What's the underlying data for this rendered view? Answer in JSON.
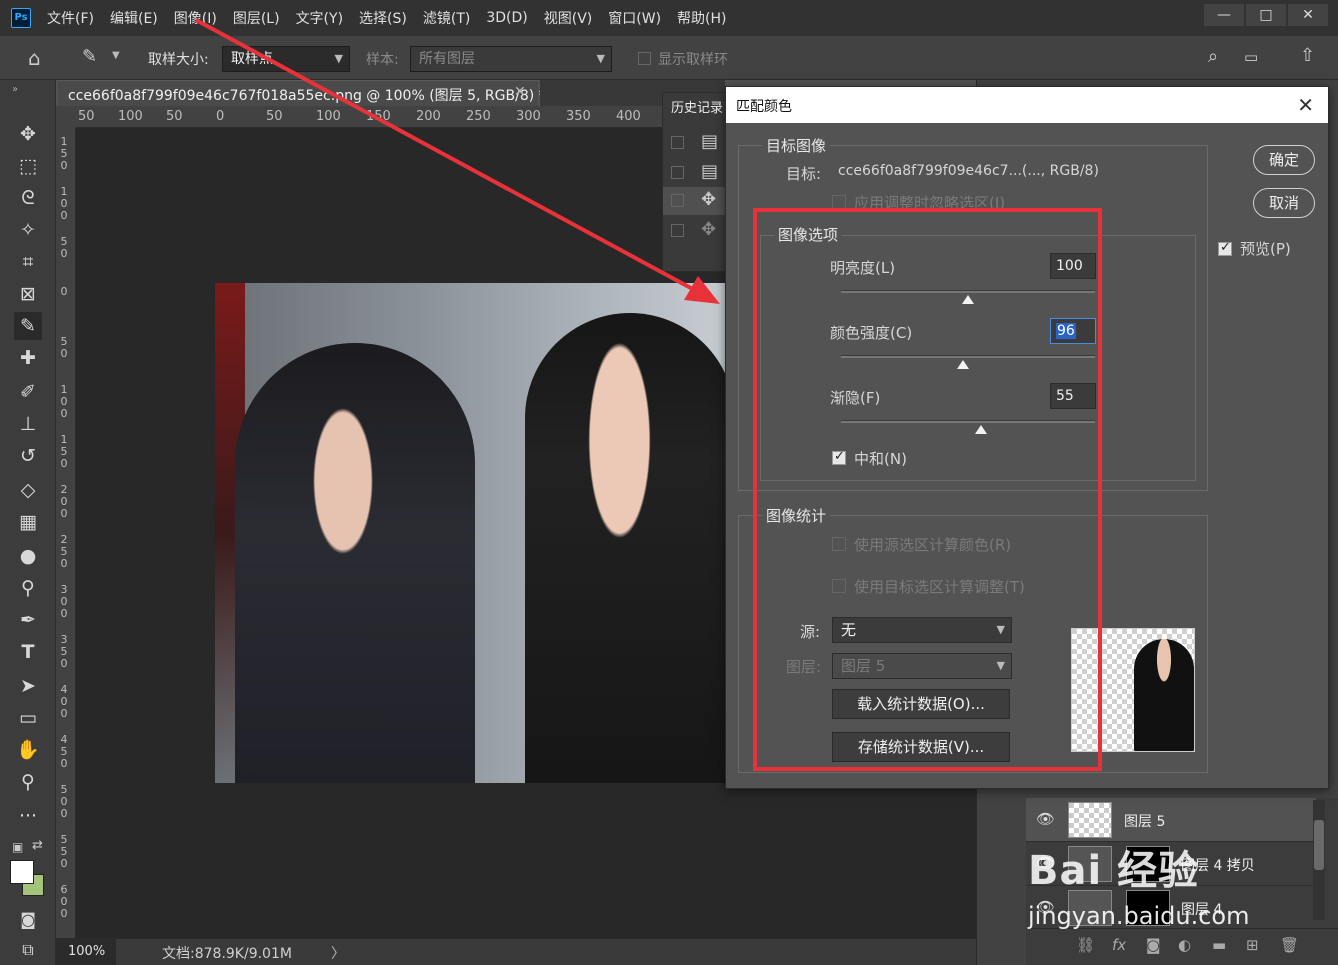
{
  "app": {
    "logo": "Ps"
  },
  "menu": [
    "文件(F)",
    "编辑(E)",
    "图像(I)",
    "图层(L)",
    "文字(Y)",
    "选择(S)",
    "滤镜(T)",
    "3D(D)",
    "视图(V)",
    "窗口(W)",
    "帮助(H)"
  ],
  "window_controls": {
    "minimize": "—",
    "maximize": "□",
    "close": "✕"
  },
  "options": {
    "sample_size_label": "取样大小:",
    "sample_size_value": "取样点",
    "sample_label": "样本:",
    "sample_value": "所有图层",
    "show_ring_label": "显示取样环"
  },
  "document": {
    "tab_title": "cce66f0a8f799f09e46c767f018a55ec.png @ 100% (图层 5, RGB/8) *",
    "zoom": "100%",
    "info": "文档:878.9K/9.01M",
    "status_arrow": "〉"
  },
  "ruler": {
    "h": [
      "50",
      "100",
      "50",
      "0",
      "50",
      "100",
      "150",
      "200",
      "250",
      "300",
      "350",
      "400"
    ],
    "v": [
      "150",
      "100",
      "50",
      "0",
      "50",
      "100",
      "150",
      "200",
      "250",
      "300",
      "350",
      "400",
      "450",
      "500",
      "550",
      "600"
    ]
  },
  "history": {
    "title": "历史记录"
  },
  "dialog": {
    "title": "匹配颜色",
    "target_group": "目标图像",
    "target_label": "目标:",
    "target_value": "cce66f0a8f799f09e46c7...(..., RGB/8)",
    "ignore_selection": "应用调整时忽略选区(I)",
    "options_group": "图像选项",
    "luminance_label": "明亮度(L)",
    "luminance_value": "100",
    "luminance_level": 0.5,
    "intensity_label": "颜色强度(C)",
    "intensity_value": "96",
    "intensity_level": 0.48,
    "fade_label": "渐隐(F)",
    "fade_value": "55",
    "fade_level": 0.55,
    "neutralize_label": "中和(N)",
    "neutralize_checked": true,
    "stats_group": "图像统计",
    "use_source_sel": "使用源选区计算颜色(R)",
    "use_target_sel": "使用目标选区计算调整(T)",
    "source_label": "源:",
    "source_value": "无",
    "layer_label": "图层:",
    "layer_value": "图层 5",
    "load_stats": "载入统计数据(O)...",
    "save_stats": "存储统计数据(V)...",
    "ok": "确定",
    "cancel": "取消",
    "preview_label": "预览(P)",
    "preview_checked": true
  },
  "layers": [
    {
      "name": "图层 5",
      "selected": true
    },
    {
      "name": "图层 4 拷贝",
      "selected": false
    },
    {
      "name": "图层 4",
      "selected": false
    }
  ],
  "watermark": {
    "main": "Bai 经验",
    "sub": "jingyan.baidu.com"
  },
  "annotation": {
    "color": "#e8323a"
  }
}
